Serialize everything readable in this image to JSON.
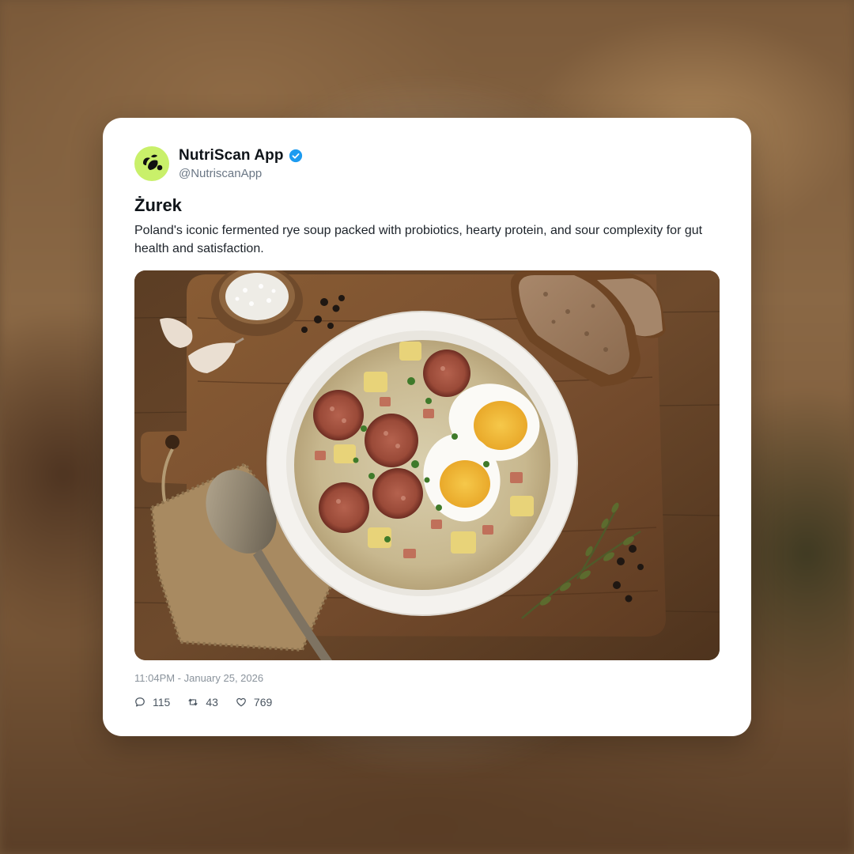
{
  "post": {
    "author": {
      "display_name": "NutriScan App",
      "handle": "@NutriscanApp",
      "verified": true
    },
    "title": "Żurek",
    "description": "Poland's iconic fermented rye soup packed with probiotics, hearty protein, and sour complexity for gut health and satisfaction.",
    "timestamp": "11:04PM - January 25, 2026",
    "stats": {
      "replies": "115",
      "reposts": "43",
      "likes": "769"
    }
  },
  "colors": {
    "avatar_bg": "#c9f06a",
    "verified_blue": "#1d9bf0",
    "text_primary": "#0f1419",
    "text_secondary": "#6b7785"
  },
  "icons": {
    "avatar": "leaf-logo-icon",
    "verified": "verified-check-icon",
    "reply": "comment-icon",
    "repost": "repost-icon",
    "like": "heart-icon"
  }
}
